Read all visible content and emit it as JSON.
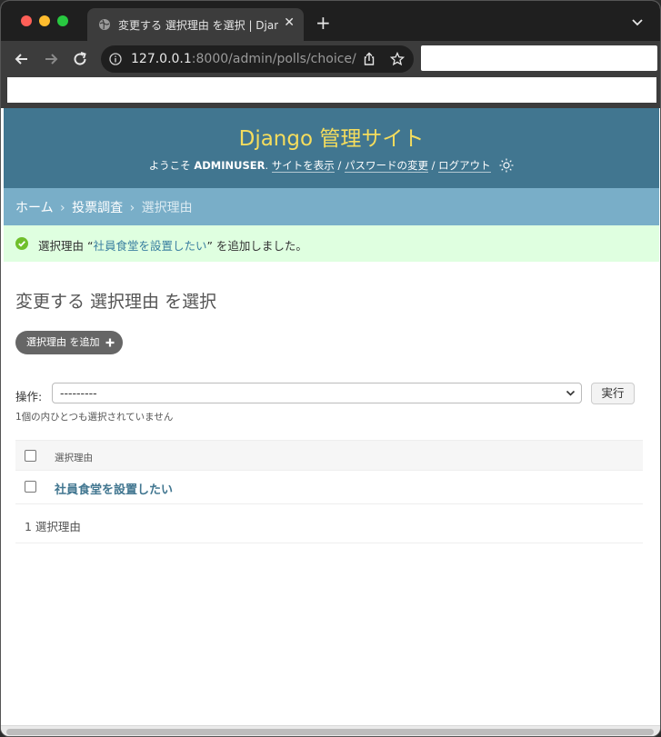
{
  "browser": {
    "tab_title": "変更する 選択理由 を選択 | Django",
    "tab_close": "✕",
    "new_tab": "+",
    "url_host": "127.0.0.1",
    "url_path": ":8000/admin/polls/choice/"
  },
  "header": {
    "branding": "Django 管理サイト",
    "welcome": "ようこそ",
    "username": "ADMINUSER",
    "period": ".",
    "view_site": "サイトを表示",
    "separator": "/",
    "change_password": "パスワードの変更",
    "logout": "ログアウト"
  },
  "breadcrumbs": {
    "home": "ホーム",
    "app": "投票調査",
    "current": "選択理由",
    "separator": "›"
  },
  "message": {
    "prefix": "選択理由 “",
    "object_link": "社員食堂を設置したい",
    "suffix": "” を追加しました。"
  },
  "page_title": "変更する 選択理由 を選択",
  "add_button": "選択理由 を追加",
  "actions": {
    "label": "操作:",
    "selected_option": "---------",
    "go_button": "実行",
    "counter": "1個の内ひとつも選択されていません"
  },
  "table": {
    "column_header": "選択理由",
    "rows": [
      {
        "label": "社員食堂を設置したい"
      }
    ]
  },
  "paginator": "1 選択理由"
}
